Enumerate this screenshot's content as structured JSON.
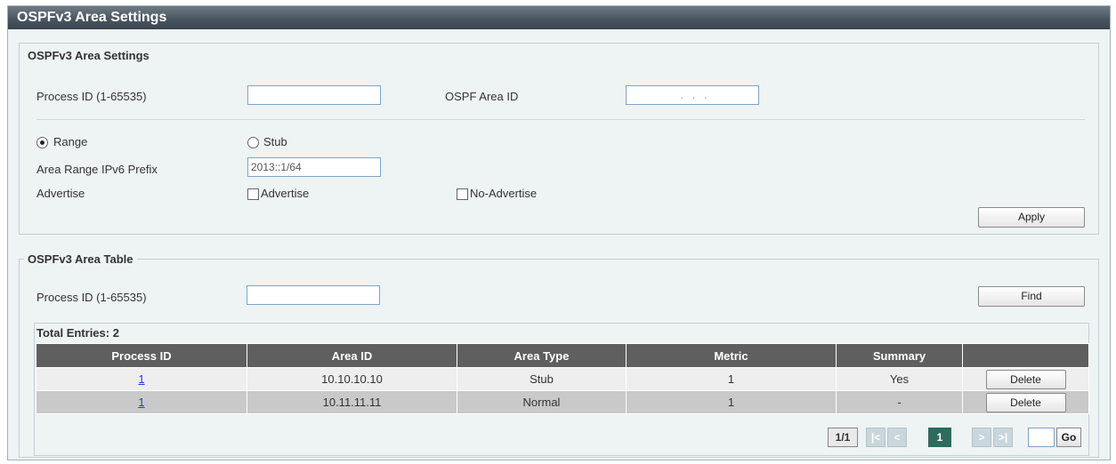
{
  "window": {
    "title": "OSPFv3 Area Settings"
  },
  "settings": {
    "legend": "OSPFv3 Area Settings",
    "process_id_label": "Process ID (1-65535)",
    "process_id_value": "",
    "area_id_label": "OSPF Area ID",
    "area_id_value": ".   .   .",
    "range_label": "Range",
    "stub_label": "Stub",
    "selected": "Range",
    "prefix_label": "Area Range IPv6 Prefix",
    "prefix_value": "2013::1/64",
    "advertise_label": "Advertise",
    "advertise_opt": "Advertise",
    "no_advertise_opt": "No-Advertise",
    "apply_label": "Apply"
  },
  "table_section": {
    "legend": "OSPFv3 Area Table",
    "process_id_label": "Process ID (1-65535)",
    "process_id_value": "",
    "find_label": "Find",
    "total_entries": "Total Entries: 2",
    "columns": [
      "Process ID",
      "Area ID",
      "Area Type",
      "Metric",
      "Summary",
      ""
    ],
    "rows": [
      {
        "process_id": "1",
        "area_id": "10.10.10.10",
        "area_type": "Stub",
        "metric": "1",
        "summary": "Yes",
        "action": "Delete"
      },
      {
        "process_id": "1",
        "area_id": "10.11.11.11",
        "area_type": "Normal",
        "metric": "1",
        "summary": "-",
        "action": "Delete"
      }
    ]
  },
  "pagination": {
    "page_info": "1/1",
    "first": "|<",
    "prev": "<",
    "current": "1",
    "next": ">",
    "last": ">|",
    "go_label": "Go",
    "go_value": ""
  },
  "colors": {
    "title_bar": "#4a5660",
    "header_bg": "#5f5f5f",
    "link": "#1a3fd3",
    "page_current": "#2e6b5f"
  }
}
